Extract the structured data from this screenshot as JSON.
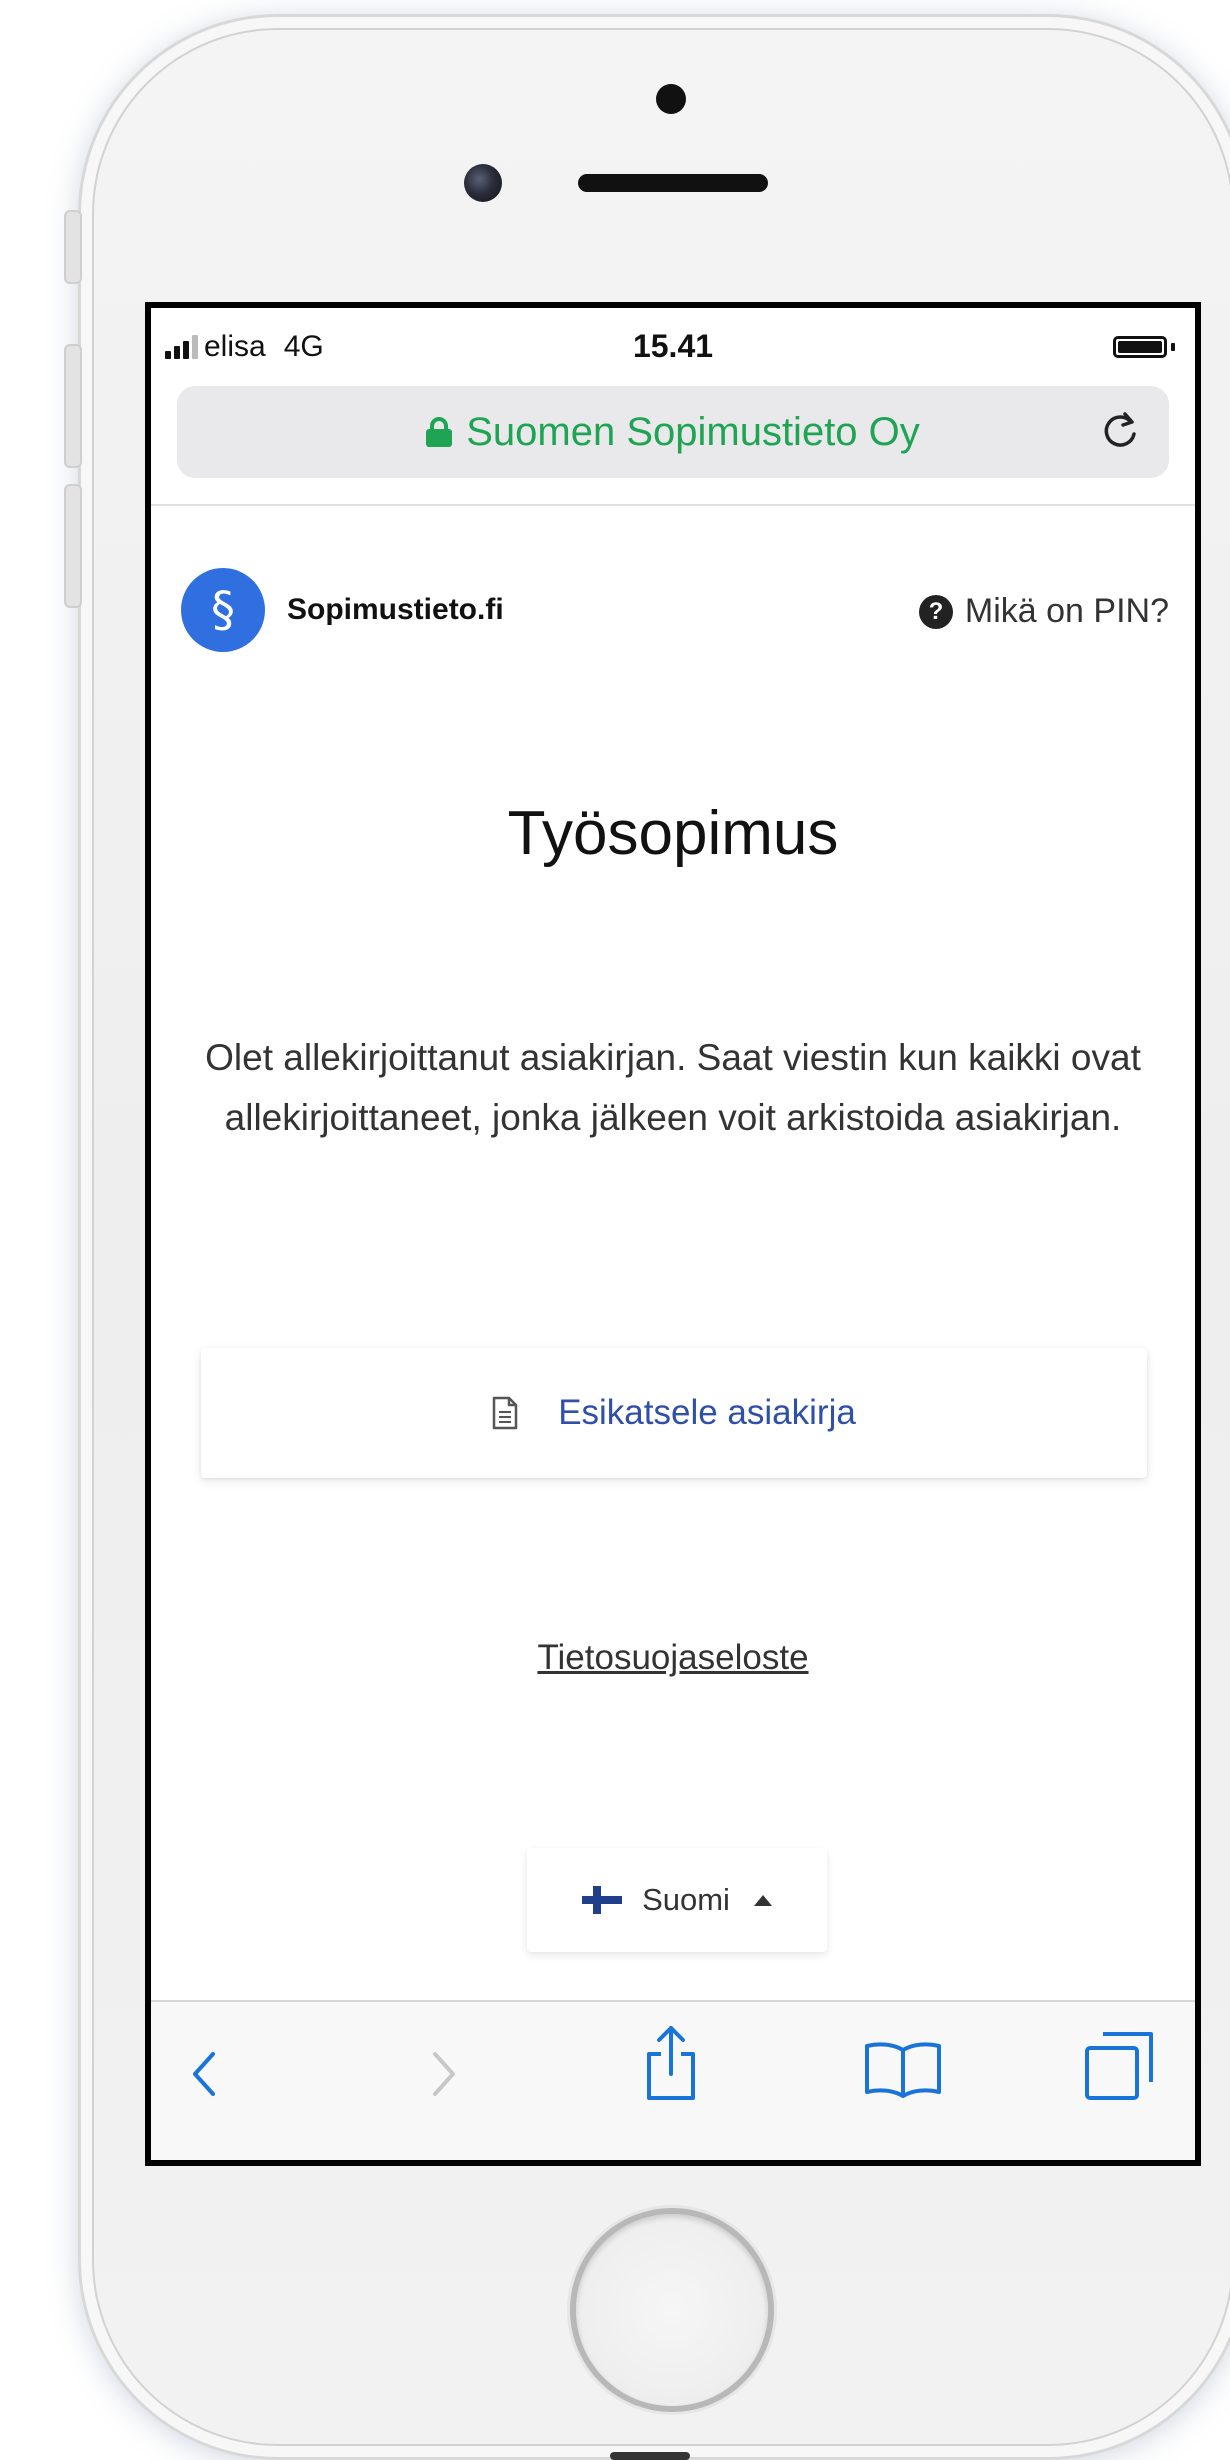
{
  "status_bar": {
    "carrier": "elisa",
    "network": "4G",
    "time": "15.41"
  },
  "url_bar": {
    "site_name": "Suomen Sopimustieto Oy"
  },
  "header": {
    "logo_symbol": "§",
    "brand_name": "Sopimustieto.fi",
    "help_icon": "?",
    "help_link": "Mikä on PIN?"
  },
  "main": {
    "title": "Työsopimus",
    "message": "Olet allekirjoittanut asiakirjan. Saat viestin kun kaikki ovat allekirjoittaneet, jonka jälkeen voit arkistoida asiakirjan.",
    "preview_button": "Esikatsele asiakirja",
    "privacy_link": "Tietosuojaseloste",
    "language": "Suomi"
  },
  "colors": {
    "secure_green": "#1fa453",
    "brand_blue": "#2f6fe0",
    "link_blue": "#2f4fa8",
    "ios_blue": "#1a73d9"
  },
  "icons": [
    "lock-icon",
    "reload-icon",
    "help-icon",
    "document-icon",
    "finland-flag-icon",
    "caret-up-icon",
    "back-icon",
    "forward-icon",
    "share-icon",
    "bookmarks-icon",
    "tabs-icon"
  ]
}
